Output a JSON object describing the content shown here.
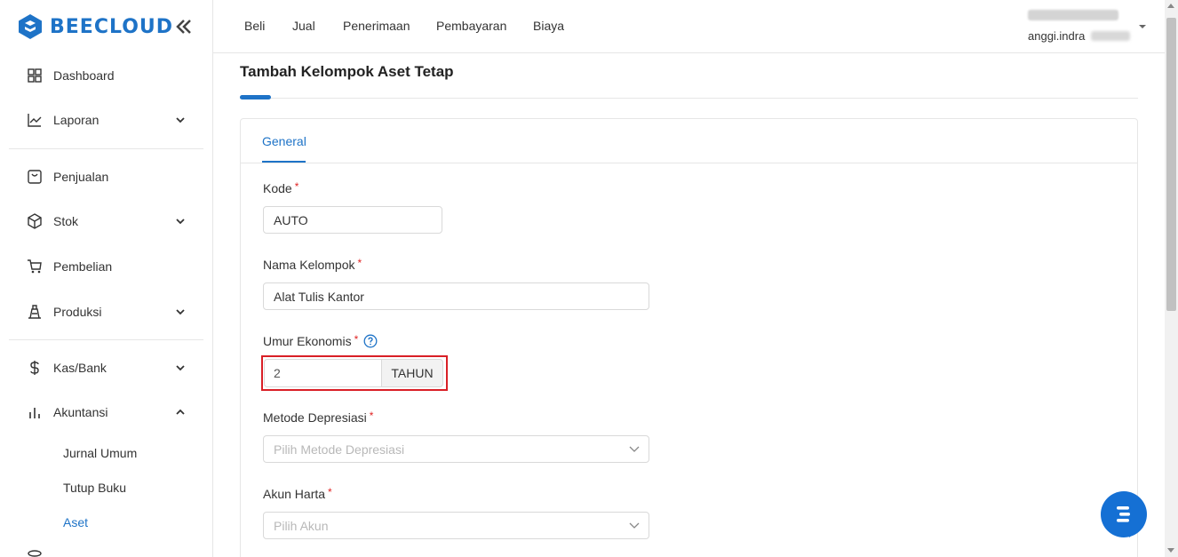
{
  "brand": {
    "name": "BEECLOUD",
    "color": "#1e73c7"
  },
  "sidebar": {
    "items": [
      {
        "label": "Dashboard",
        "icon": "grid-icon"
      },
      {
        "label": "Laporan",
        "icon": "line-chart-icon",
        "expandable": true
      },
      {
        "label": "Penjualan",
        "icon": "receipt-icon"
      },
      {
        "label": "Stok",
        "icon": "box-icon",
        "expandable": true
      },
      {
        "label": "Pembelian",
        "icon": "cart-icon"
      },
      {
        "label": "Produksi",
        "icon": "factory-icon",
        "expandable": true
      },
      {
        "label": "Kas/Bank",
        "icon": "dollar-icon",
        "expandable": true
      },
      {
        "label": "Akuntansi",
        "icon": "bar-chart-icon",
        "expanded": true
      }
    ],
    "akuntansi_sub": [
      "Jurnal Umum",
      "Tutup Buku",
      "Aset"
    ],
    "active_sub": "Aset"
  },
  "topbar": {
    "menu": [
      "Beli",
      "Jual",
      "Penerimaan",
      "Pembayaran",
      "Biaya"
    ],
    "user_email": "anggi.indra"
  },
  "page": {
    "title": "Tambah Kelompok Aset Tetap",
    "tabs": [
      "General"
    ],
    "active_tab": "General"
  },
  "form": {
    "kode": {
      "label": "Kode",
      "value": "AUTO",
      "required": true
    },
    "nama_kelompok": {
      "label": "Nama Kelompok",
      "value": "Alat Tulis Kantor",
      "required": true
    },
    "umur_ekonomis": {
      "label": "Umur Ekonomis",
      "value": "2",
      "suffix": "TAHUN",
      "required": true
    },
    "metode_depresiasi": {
      "label": "Metode Depresiasi",
      "placeholder": "Pilih Metode Depresiasi",
      "required": true
    },
    "akun_harta": {
      "label": "Akun Harta",
      "placeholder": "Pilih Akun",
      "required": true
    }
  },
  "highlight_color": "#d91f26",
  "required_marker": "*"
}
